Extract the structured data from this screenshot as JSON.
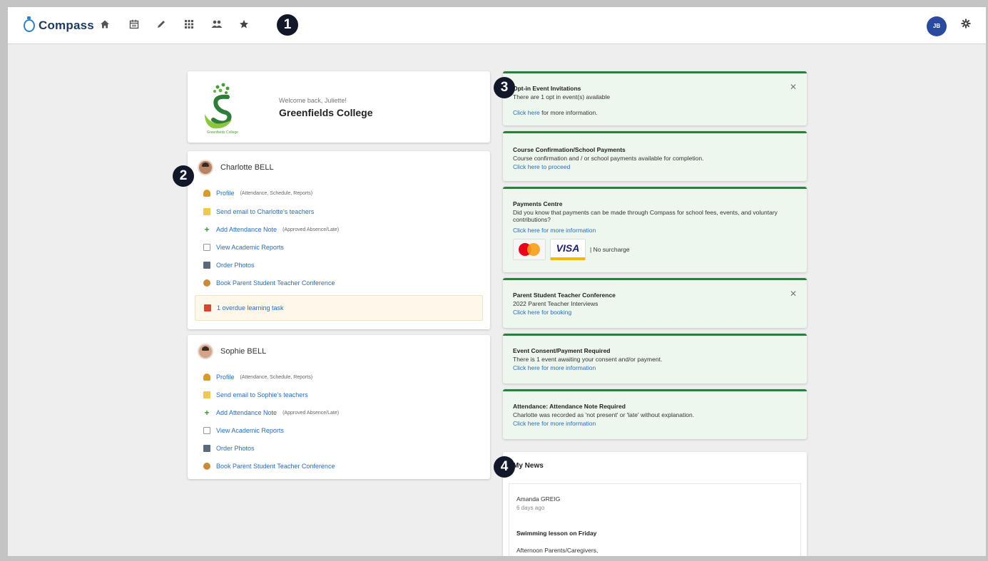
{
  "app": {
    "name": "Compass",
    "user_initials": "JB"
  },
  "markers": [
    "1",
    "2",
    "3",
    "4"
  ],
  "welcome": {
    "greeting": "Welcome back, Juliette!",
    "school": "Greenfields College",
    "logo_caption": "Greenfields College"
  },
  "students": [
    {
      "name": "Charlotte BELL",
      "links": [
        {
          "label": "Profile",
          "note": "(Attendance, Schedule, Reports)",
          "icon": "profile-icon"
        },
        {
          "label": "Send email to Charlotte's teachers",
          "note": "",
          "icon": "email-icon"
        },
        {
          "label": "Add Attendance Note",
          "note": "(Approved Absence/Late)",
          "icon": "plus-icon"
        },
        {
          "label": "View Academic Reports",
          "note": "",
          "icon": "report-icon"
        },
        {
          "label": "Order Photos",
          "note": "",
          "icon": "camera-icon"
        },
        {
          "label": "Book Parent Student Teacher Conference",
          "note": "",
          "icon": "conference-icon"
        }
      ],
      "task": "1 overdue learning task"
    },
    {
      "name": "Sophie BELL",
      "links": [
        {
          "label": "Profile",
          "note": "(Attendance, Schedule, Reports)",
          "icon": "profile-icon"
        },
        {
          "label": "Send email to Sophie's teachers",
          "note": "",
          "icon": "email-icon"
        },
        {
          "label": "Add Attendance Note",
          "note": "(Approved Absence/Late)",
          "icon": "plus-icon"
        },
        {
          "label": "View Academic Reports",
          "note": "",
          "icon": "report-icon"
        },
        {
          "label": "Order Photos",
          "note": "",
          "icon": "camera-icon"
        },
        {
          "label": "Book Parent Student Teacher Conference",
          "note": "",
          "icon": "conference-icon"
        }
      ]
    }
  ],
  "notices": {
    "optin": {
      "title": "Opt-in Event Invitations",
      "text": "There are 1 opt in event(s) available",
      "link": "Click here",
      "link_rest": " for more information."
    },
    "course": {
      "title": "Course Confirmation/School Payments",
      "text": "Course confirmation and / or school payments available for completion.",
      "link": "Click here to proceed"
    },
    "payments": {
      "title": "Payments Centre",
      "text": "Did you know that payments can be made through Compass for school fees, events, and voluntary contributions?",
      "link": "Click here for more information",
      "visa": "VISA",
      "surcharge": "|  No surcharge"
    },
    "conference": {
      "title": "Parent Student Teacher Conference",
      "text": "2022 Parent Teacher Interviews",
      "link": "Click here for booking"
    },
    "consent": {
      "title": "Event Consent/Payment Required",
      "text": "There is 1 event awaiting your consent and/or payment.",
      "link": "Click here for more information"
    },
    "attendance": {
      "title": "Attendance: Attendance Note Required",
      "text": "Charlotte was recorded as 'not present' or 'late' without explanation.",
      "link": "Click here for more information"
    },
    "close_glyph": "✕"
  },
  "news": {
    "title": "My News",
    "author": "Amanda GREIG",
    "time": "6 days ago",
    "headline": "Swimming lesson on Friday",
    "body": "Afternoon Parents/Caregivers,"
  },
  "colors": {
    "accent": "#2a6db5",
    "notice_border": "#2e7d3a",
    "notice_bg": "#eef7ee",
    "marker": "#10182a"
  }
}
